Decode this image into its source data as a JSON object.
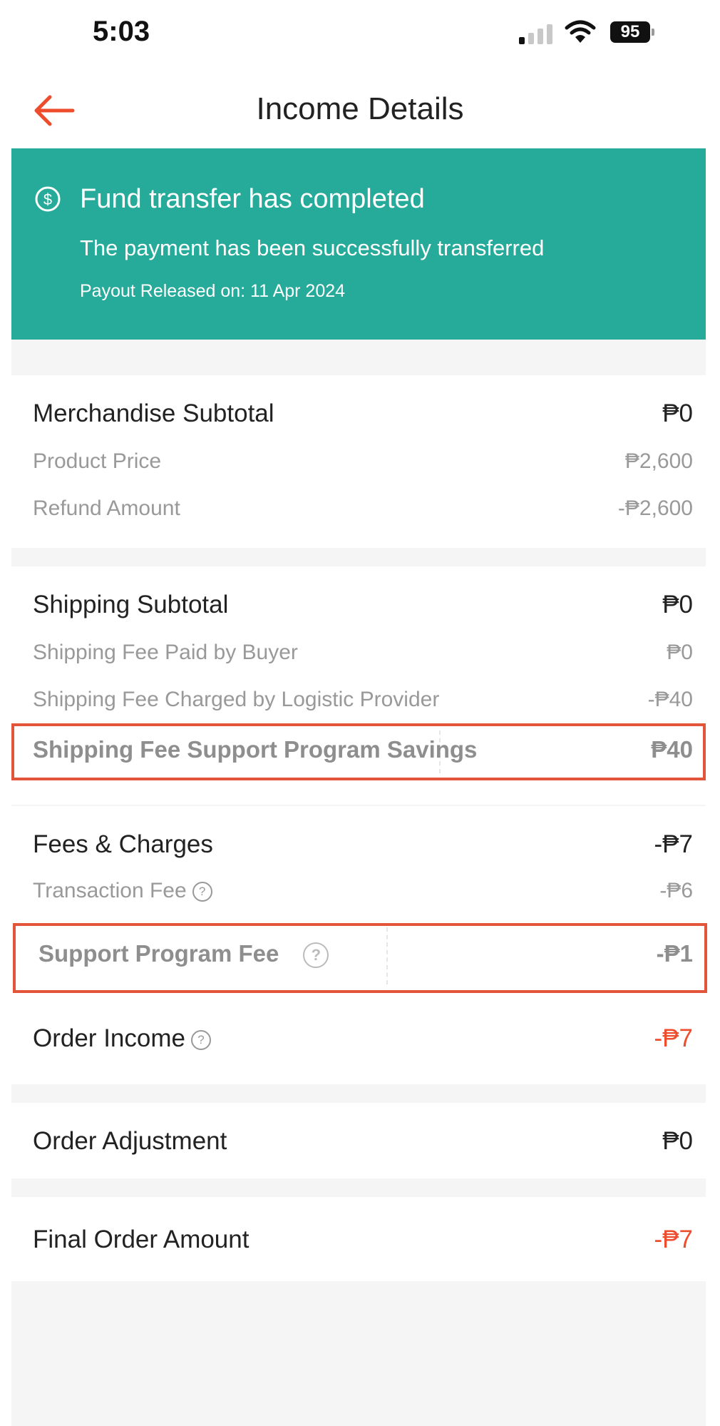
{
  "status_bar": {
    "time": "5:03",
    "battery": "95"
  },
  "header": {
    "title": "Income Details"
  },
  "banner": {
    "title": "Fund transfer has completed",
    "subtitle": "The payment has been successfully transferred",
    "payout": "Payout Released on: 11 Apr 2024",
    "color": "#26aa99"
  },
  "merchandise": {
    "title": "Merchandise Subtotal",
    "total": "₱0",
    "rows": [
      {
        "label": "Product Price",
        "value": "₱2,600"
      },
      {
        "label": "Refund Amount",
        "value": "-₱2,600"
      }
    ]
  },
  "shipping": {
    "title": "Shipping Subtotal",
    "total": "₱0",
    "rows": [
      {
        "label": "Shipping Fee Paid by Buyer",
        "value": "₱0"
      },
      {
        "label": "Shipping Fee Charged by Logistic Provider",
        "value": "-₱40"
      },
      {
        "label": "Shipping Fee Support Program Savings",
        "value": "₱40"
      }
    ]
  },
  "fees": {
    "title": "Fees & Charges",
    "total": "-₱7",
    "rows": [
      {
        "label": "Transaction Fee",
        "value": "-₱6"
      },
      {
        "label": "Support Program Fee",
        "value": "-₱1"
      }
    ]
  },
  "order_income": {
    "label": "Order Income",
    "value": "-₱7"
  },
  "order_adjustment": {
    "label": "Order Adjustment",
    "value": "₱0"
  },
  "final_order": {
    "label": "Final Order Amount",
    "value": "-₱7"
  },
  "colors": {
    "accent": "#ee4d2d",
    "highlight_box": "#e2553a"
  }
}
